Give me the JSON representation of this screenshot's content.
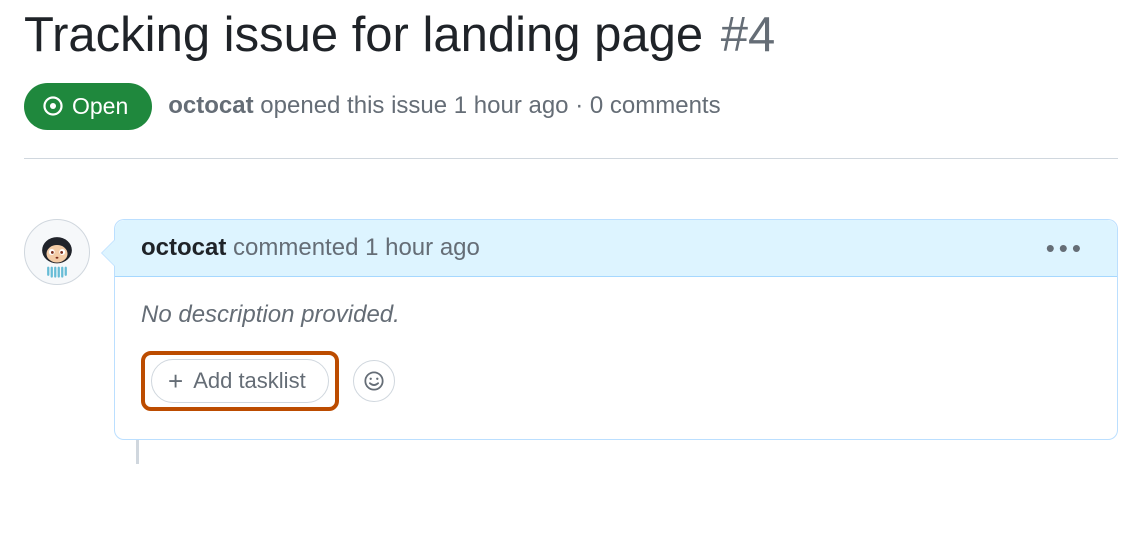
{
  "issue": {
    "title": "Tracking issue for landing page",
    "number": "#4",
    "status_label": "Open",
    "author": "octocat",
    "opened_text_prefix": "opened this issue",
    "opened_relative_time": "1 hour ago",
    "separator": "·",
    "comments_count_text": "0 comments"
  },
  "comment": {
    "author": "octocat",
    "action_text": "commented",
    "relative_time": "1 hour ago",
    "body_placeholder": "No description provided.",
    "add_tasklist_label": "Add tasklist"
  }
}
